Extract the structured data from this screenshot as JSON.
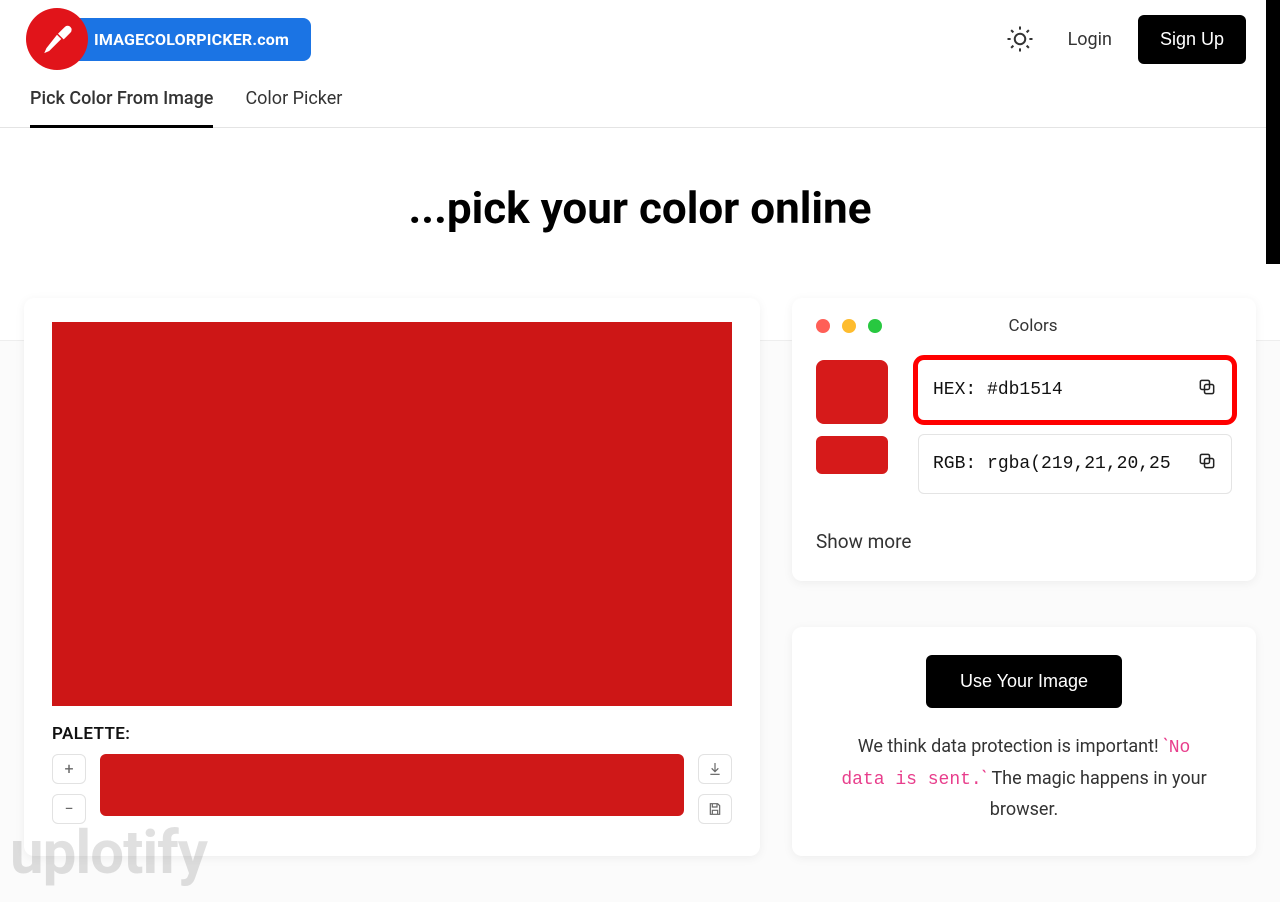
{
  "header": {
    "brand": "IMAGECOLORPICKER.com",
    "login": "Login",
    "signup": "Sign Up"
  },
  "tabs": [
    "Pick Color From Image",
    "Color Picker"
  ],
  "hero_title": "...pick your color online",
  "image": {
    "color": "#cd1616"
  },
  "palette": {
    "label": "PALETTE:",
    "strip_color": "#cf1818"
  },
  "colors_panel": {
    "title": "Colors",
    "swatch_big": "#d61a1a",
    "swatch_small": "#d61a1a",
    "hex": {
      "label": "HEX:",
      "value": "#db1514"
    },
    "rgb": {
      "label": "RGB:",
      "value": "rgba(219,21,20,25"
    },
    "show_more": "Show more"
  },
  "use_panel": {
    "button": "Use Your Image",
    "text_before": "We think data protection is important! ",
    "code": "No data is sent.",
    "text_after": " The magic happens in your browser."
  },
  "watermark": "uplotify"
}
